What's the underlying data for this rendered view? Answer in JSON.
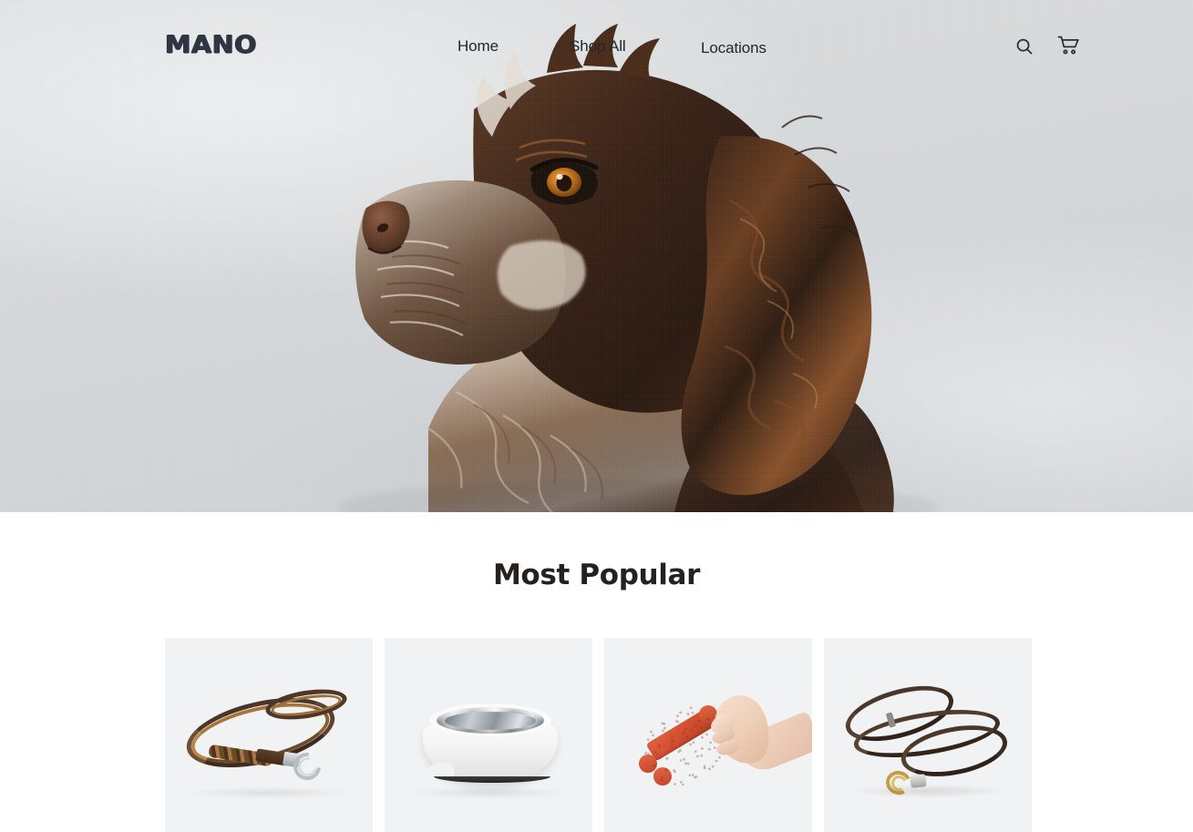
{
  "brand": {
    "logo_text": "MANO"
  },
  "nav": {
    "links": [
      {
        "label": "Home",
        "name": "nav-link-home"
      },
      {
        "label": "Shop All",
        "name": "nav-link-shop-all"
      },
      {
        "label": "Locations",
        "name": "nav-link-locations"
      }
    ],
    "actions": [
      {
        "icon": "search-icon",
        "label": "Search"
      },
      {
        "icon": "shopping-cart-icon",
        "label": "Cart"
      }
    ]
  },
  "hero": {
    "image_alt": "Brown and white cocker spaniel dog in profile against a light grey wall",
    "background_color": "#d7d9db"
  },
  "section": {
    "title": "Most Popular",
    "title_color": "#25211e"
  },
  "products": [
    {
      "name": "product-card-braided-leather-leash",
      "image_alt": "Brown braided leather dog leash with silver clip",
      "background_color": "#f1f2f4"
    },
    {
      "name": "product-card-dog-bowl",
      "image_alt": "White dog bowl with stainless steel insert",
      "background_color": "#f1f2f4"
    },
    {
      "name": "product-card-bone-treat",
      "image_alt": "Hand holding a red bone-shaped dog treat",
      "background_color": "#f1f2f4"
    },
    {
      "name": "product-card-dark-leather-leash",
      "image_alt": "Dark brown leather dog leash with brass clip",
      "background_color": "#f1f2f4"
    }
  ],
  "theme": {
    "page_background": "#ffffff",
    "text_color": "#23262b",
    "logo_color": "#2f3542"
  }
}
